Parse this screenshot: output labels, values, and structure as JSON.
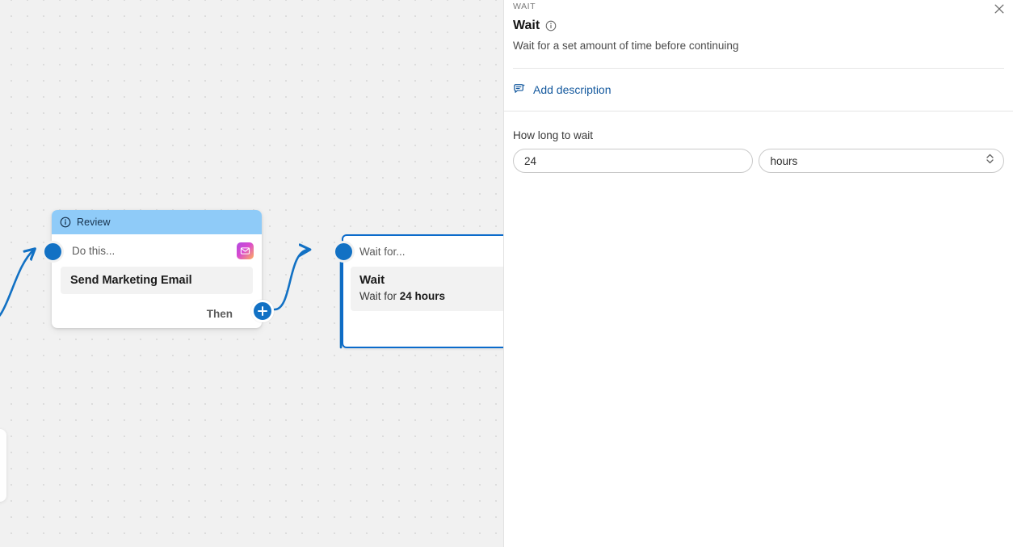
{
  "canvas": {
    "nodes": [
      {
        "id": "review-node",
        "banner_label": "Review",
        "banner_icon": "info-circle-icon",
        "head_label": "Do this...",
        "head_icon": "email-gradient-icon",
        "field_text": "Send Marketing Email",
        "then_label": "Then",
        "add_icon": "plus-icon"
      },
      {
        "id": "wait-node",
        "head_label": "Wait for...",
        "body_title": "Wait",
        "body_sub_prefix": "Wait for ",
        "body_sub_strong": "24 hours",
        "selected": true
      }
    ],
    "accent_color": "#1271c4",
    "banner_color": "#8fcbf8",
    "selection_color": "#0b6bcb"
  },
  "panel": {
    "eyebrow": "WAIT",
    "close_icon": "close-icon",
    "title": "Wait",
    "title_info_icon": "info-circle-icon",
    "subtitle": "Wait for a set amount of time before continuing",
    "add_description": {
      "label": "Add description",
      "icon": "description-sparkle-icon",
      "color": "#14599e"
    },
    "form": {
      "label": "How long to wait",
      "amount_value": "24",
      "amount_placeholder": "24",
      "unit_value": "hours",
      "unit_placeholder": "hours",
      "unit_icon": "stepper-chevrons-icon"
    }
  }
}
